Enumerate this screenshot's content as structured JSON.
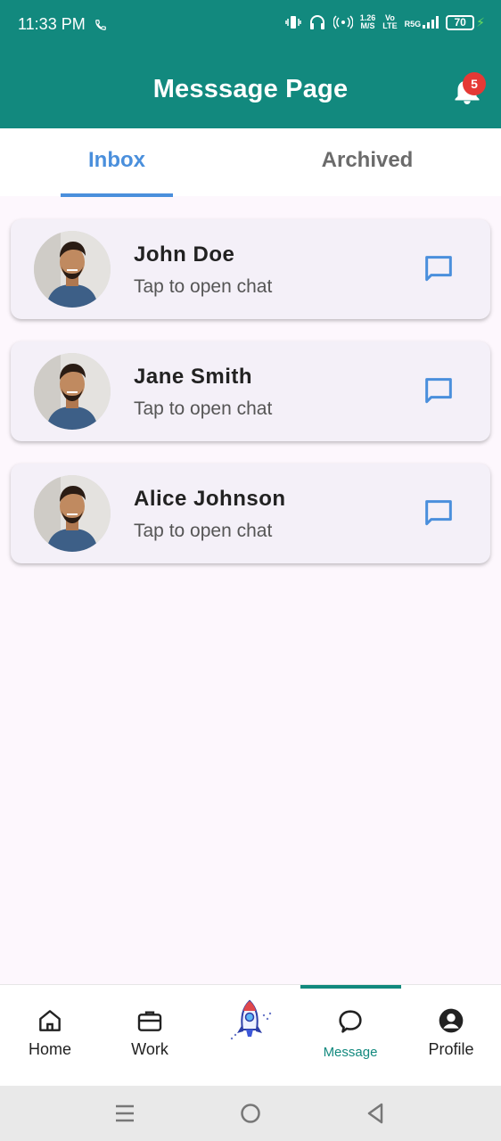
{
  "status_bar": {
    "time": "11:33 PM",
    "speed_value": "1.26",
    "speed_unit": "M/S",
    "network_vo": "Vo",
    "network_lte": "LTE",
    "network_r5g": "R5G",
    "battery_level": "70"
  },
  "app_bar": {
    "title": "Messsage Page",
    "notification_count": "5"
  },
  "tabs": [
    {
      "label": "Inbox",
      "active": true
    },
    {
      "label": "Archived",
      "active": false
    }
  ],
  "chats": [
    {
      "name": "John Doe",
      "subtitle": "Tap to open chat"
    },
    {
      "name": "Jane Smith",
      "subtitle": "Tap to open chat"
    },
    {
      "name": "Alice Johnson",
      "subtitle": "Tap to open chat"
    }
  ],
  "bottom_nav": {
    "items": [
      {
        "label": "Home",
        "icon": "home-icon"
      },
      {
        "label": "Work",
        "icon": "briefcase-icon"
      },
      {
        "label": "",
        "icon": "rocket-icon"
      },
      {
        "label": "Message",
        "icon": "chat-bubble-icon",
        "active": true
      },
      {
        "label": "Profile",
        "icon": "account-circle-icon"
      }
    ]
  },
  "colors": {
    "primary": "#12897e",
    "accent": "#4a8fdc",
    "badge": "#e53935",
    "page_bg": "#fdf7fd",
    "card_bg": "#f4f0f8"
  }
}
